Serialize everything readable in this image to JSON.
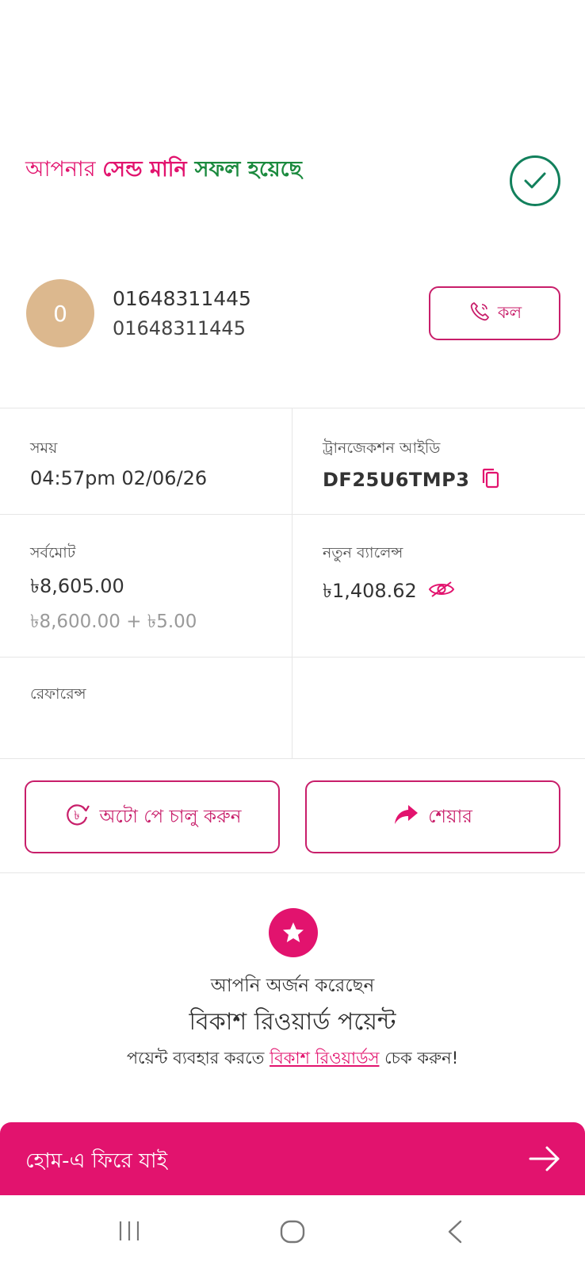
{
  "headline": {
    "part1": "আপনার ",
    "part2": "সেন্ড মানি",
    "part3": "সফল হয়েছে"
  },
  "contact": {
    "avatar_initial": "0",
    "name": "01648311445",
    "number": "01648311445",
    "call_label": "কল"
  },
  "details": {
    "time_label": "সময়",
    "time_value": "04:57pm 02/06/26",
    "trx_label": "ট্রানজেকশন আইডি",
    "trx_value": "DF25U6TMP3",
    "total_label": "সর্বমোট",
    "total_value": "৳8,605.00",
    "total_breakdown": "৳8,600.00 + ৳5.00",
    "balance_label": "নতুন ব্যালেন্স",
    "balance_value": "৳1,408.62",
    "reference_label": "রেফারেন্স"
  },
  "actions": {
    "autopay_label": "অটো পে চালু করুন",
    "share_label": "শেয়ার"
  },
  "reward": {
    "line1": "আপনি অর্জন করেছেন",
    "line2": "বিকাশ রিওয়ার্ড পয়েন্ট",
    "line3_pre": "পয়েন্ট ব্যবহার করতে ",
    "line3_link": "বিকাশ রিওয়ার্ডস",
    "line3_post": " চেক করুন!"
  },
  "home_button": {
    "label": "হোম-এ ফিরে যাই"
  },
  "colors": {
    "brand_pink": "#e2136e",
    "success_green": "#1b8a3e",
    "avatar_bg": "#dcb88e"
  },
  "icons": {
    "success": "check-circle-icon",
    "call": "phone-icon",
    "copy": "copy-icon",
    "balance_visibility": "eye-off-icon",
    "autopay": "taka-refresh-icon",
    "share": "share-arrow-icon",
    "reward": "star-icon",
    "home": "arrow-right-icon",
    "nav_recents": "recents-icon",
    "nav_home": "home-circle-icon",
    "nav_back": "back-chevron-icon"
  }
}
